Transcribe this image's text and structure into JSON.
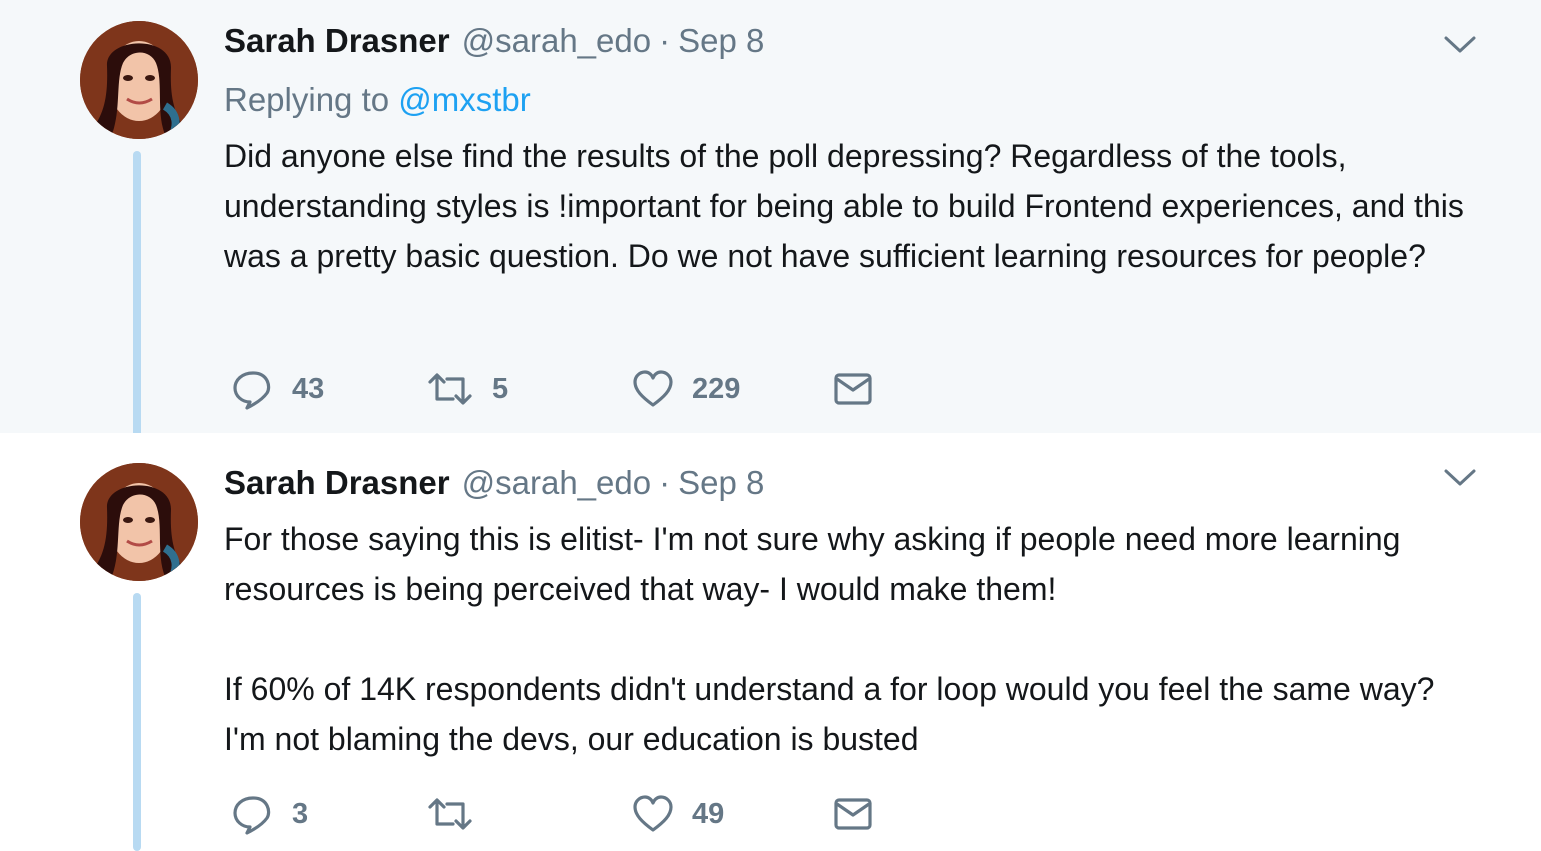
{
  "tweets": [
    {
      "author": {
        "name": "Sarah Drasner",
        "handle": "@sarah_edo"
      },
      "time": "Sep 8",
      "replying_to": {
        "prefix": "Replying to ",
        "handle": "@mxstbr"
      },
      "text": "Did anyone else find the results of the poll depressing? Regardless of the tools, understanding styles is !important for being able to build Frontend experiences, and this was a pretty basic question. Do we not have sufficient learning resources for people?",
      "actions": {
        "replies": "43",
        "retweets": "5",
        "likes": "229"
      },
      "background": "#f5f8fa"
    },
    {
      "author": {
        "name": "Sarah Drasner",
        "handle": "@sarah_edo"
      },
      "time": "Sep 8",
      "text": "For those saying this is elitist- I'm not sure why asking if people need more learning resources is being perceived that way- I would make them!\n\nIf 60% of 14K respondents didn't understand a for loop would you feel the same way? I'm not blaming the devs, our education is busted",
      "actions": {
        "replies": "3",
        "retweets": "",
        "likes": "49"
      },
      "background": "#ffffff"
    }
  ],
  "colors": {
    "accent": "#1da1f2",
    "muted": "#657786",
    "thread_line": "#b8daf2",
    "text": "#14171a"
  },
  "icons": [
    "chevron-down-icon",
    "reply-icon",
    "retweet-icon",
    "like-heart-icon",
    "direct-message-icon"
  ]
}
